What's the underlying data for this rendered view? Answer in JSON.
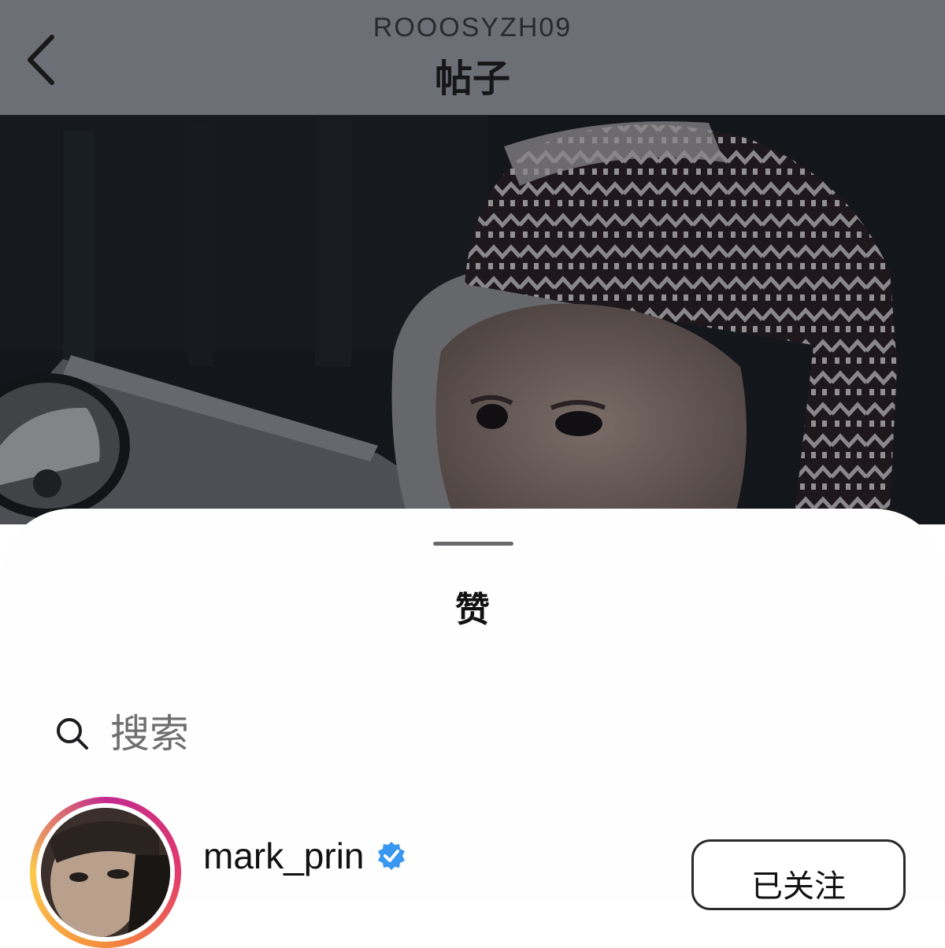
{
  "header": {
    "username": "ROOOSYZH09",
    "title": "帖子",
    "back_icon": "chevron-left-icon"
  },
  "sheet": {
    "title": "赞",
    "search": {
      "placeholder": "搜索",
      "icon": "search-icon"
    },
    "likers": [
      {
        "username": "mark_prin",
        "verified": true,
        "button_label": "已关注"
      }
    ]
  },
  "colors": {
    "header_bg": "#6d6f76",
    "sheet_bg": "#fefefe",
    "verified_badge": "#3897f0",
    "story_ring": [
      "#c22a8e",
      "#f58c3c",
      "#fbc94b"
    ]
  }
}
